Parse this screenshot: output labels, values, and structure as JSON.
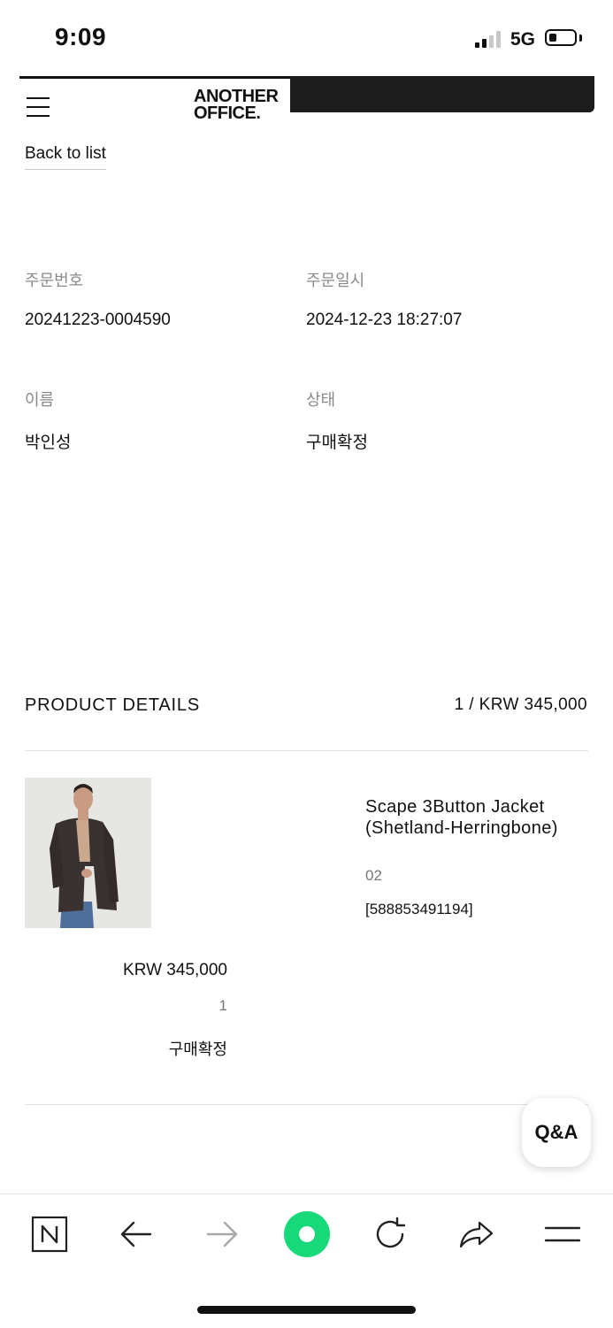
{
  "status_bar": {
    "time": "9:09",
    "network": "5G"
  },
  "header": {
    "logo_line1": "ANOTHER",
    "logo_line2": "OFFICE."
  },
  "nav": {
    "back_label": "Back to list"
  },
  "order": {
    "number_label": "주문번호",
    "number_value": "20241223-0004590",
    "date_label": "주문일시",
    "date_value": "2024-12-23 18:27:07",
    "name_label": "이름",
    "name_value": "박인성",
    "status_label": "상태",
    "status_value": "구매확정"
  },
  "product_details": {
    "title": "PRODUCT DETAILS",
    "total": "1 / KRW 345,000",
    "items": [
      {
        "name": "Scape 3Button Jacket (Shetland-Herringbone)",
        "option": "02",
        "code": "[588853491194]",
        "price": "KRW 345,000",
        "quantity": "1",
        "status": "구매확정"
      }
    ]
  },
  "qa_button": {
    "label": "Q&A"
  },
  "colors": {
    "accent_green": "#17d97a",
    "text": "#111111",
    "muted": "#8a8a8a"
  }
}
